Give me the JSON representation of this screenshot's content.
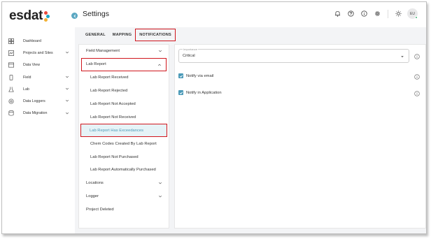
{
  "app": {
    "logo_text": "esdat"
  },
  "sidebar": {
    "items": [
      {
        "label": "Dashboard",
        "icon": "dashboard-icon",
        "has_chevron": false
      },
      {
        "label": "Projects and Sites",
        "icon": "map-icon",
        "has_chevron": true
      },
      {
        "label": "Data View",
        "icon": "table-icon",
        "has_chevron": false
      },
      {
        "label": "Field",
        "icon": "mobile-icon",
        "has_chevron": true
      },
      {
        "label": "Lab",
        "icon": "flask-icon",
        "has_chevron": true
      },
      {
        "label": "Data Loggers",
        "icon": "logger-icon",
        "has_chevron": true
      },
      {
        "label": "Data Migration",
        "icon": "database-icon",
        "has_chevron": true
      }
    ]
  },
  "header": {
    "title": "Settings",
    "icons": [
      "bell-icon",
      "help-icon",
      "info-icon",
      "gear-icon",
      "sun-icon"
    ],
    "avatar": "EU"
  },
  "tabs": [
    {
      "label": "GENERAL",
      "active": false
    },
    {
      "label": "MAPPING",
      "active": false
    },
    {
      "label": "NOTIFICATIONS",
      "active": true
    }
  ],
  "notification_list": {
    "items": [
      {
        "label": "Field Management",
        "level": "top",
        "chevron": "down"
      },
      {
        "label": "Lab Report",
        "level": "top",
        "chevron": "up",
        "boxed": true
      },
      {
        "label": "Lab Report Received",
        "level": "sub"
      },
      {
        "label": "Lab Report Rejected",
        "level": "sub"
      },
      {
        "label": "Lab Report Not Accepted",
        "level": "sub"
      },
      {
        "label": "Lab Report Not Received",
        "level": "sub"
      },
      {
        "label": "Lab Report Has Exceedances",
        "level": "sub",
        "selected": true
      },
      {
        "label": "Chem Codes Created By Lab Report",
        "level": "sub"
      },
      {
        "label": "Lab Report Not Purchased",
        "level": "sub"
      },
      {
        "label": "Lab Report Automatically Purchased",
        "level": "sub"
      },
      {
        "label": "Locations",
        "level": "top",
        "chevron": "down"
      },
      {
        "label": "Logger",
        "level": "top",
        "chevron": "down"
      },
      {
        "label": "Project Deleted",
        "level": "top"
      }
    ]
  },
  "settings_panel": {
    "importance_label": "Importance",
    "importance_value": "Critical",
    "notify_email_label": "Notify via email",
    "notify_email_checked": true,
    "notify_app_label": "Notify in Application",
    "notify_app_checked": true
  },
  "colors": {
    "accent": "#4b9ab8",
    "highlight_box": "#d0161d",
    "selected_bg": "#e6f3f7",
    "status_online": "#3cb371"
  }
}
